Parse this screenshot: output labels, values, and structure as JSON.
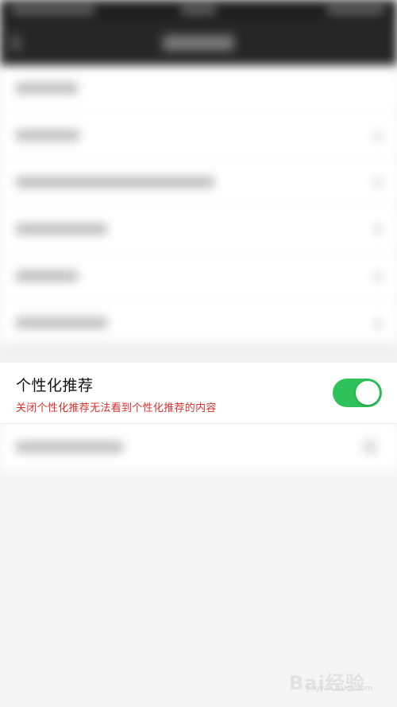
{
  "setting": {
    "title": "个性化推荐",
    "subtitle": "关闭个性化推荐无法看到个性化推荐的内容",
    "toggle_on": true,
    "toggle_color": "#2fc25b"
  },
  "subtitle_color": "#d6302a",
  "watermark": {
    "text": "Bai经验",
    "sub": "jingyan.baidu.com"
  }
}
